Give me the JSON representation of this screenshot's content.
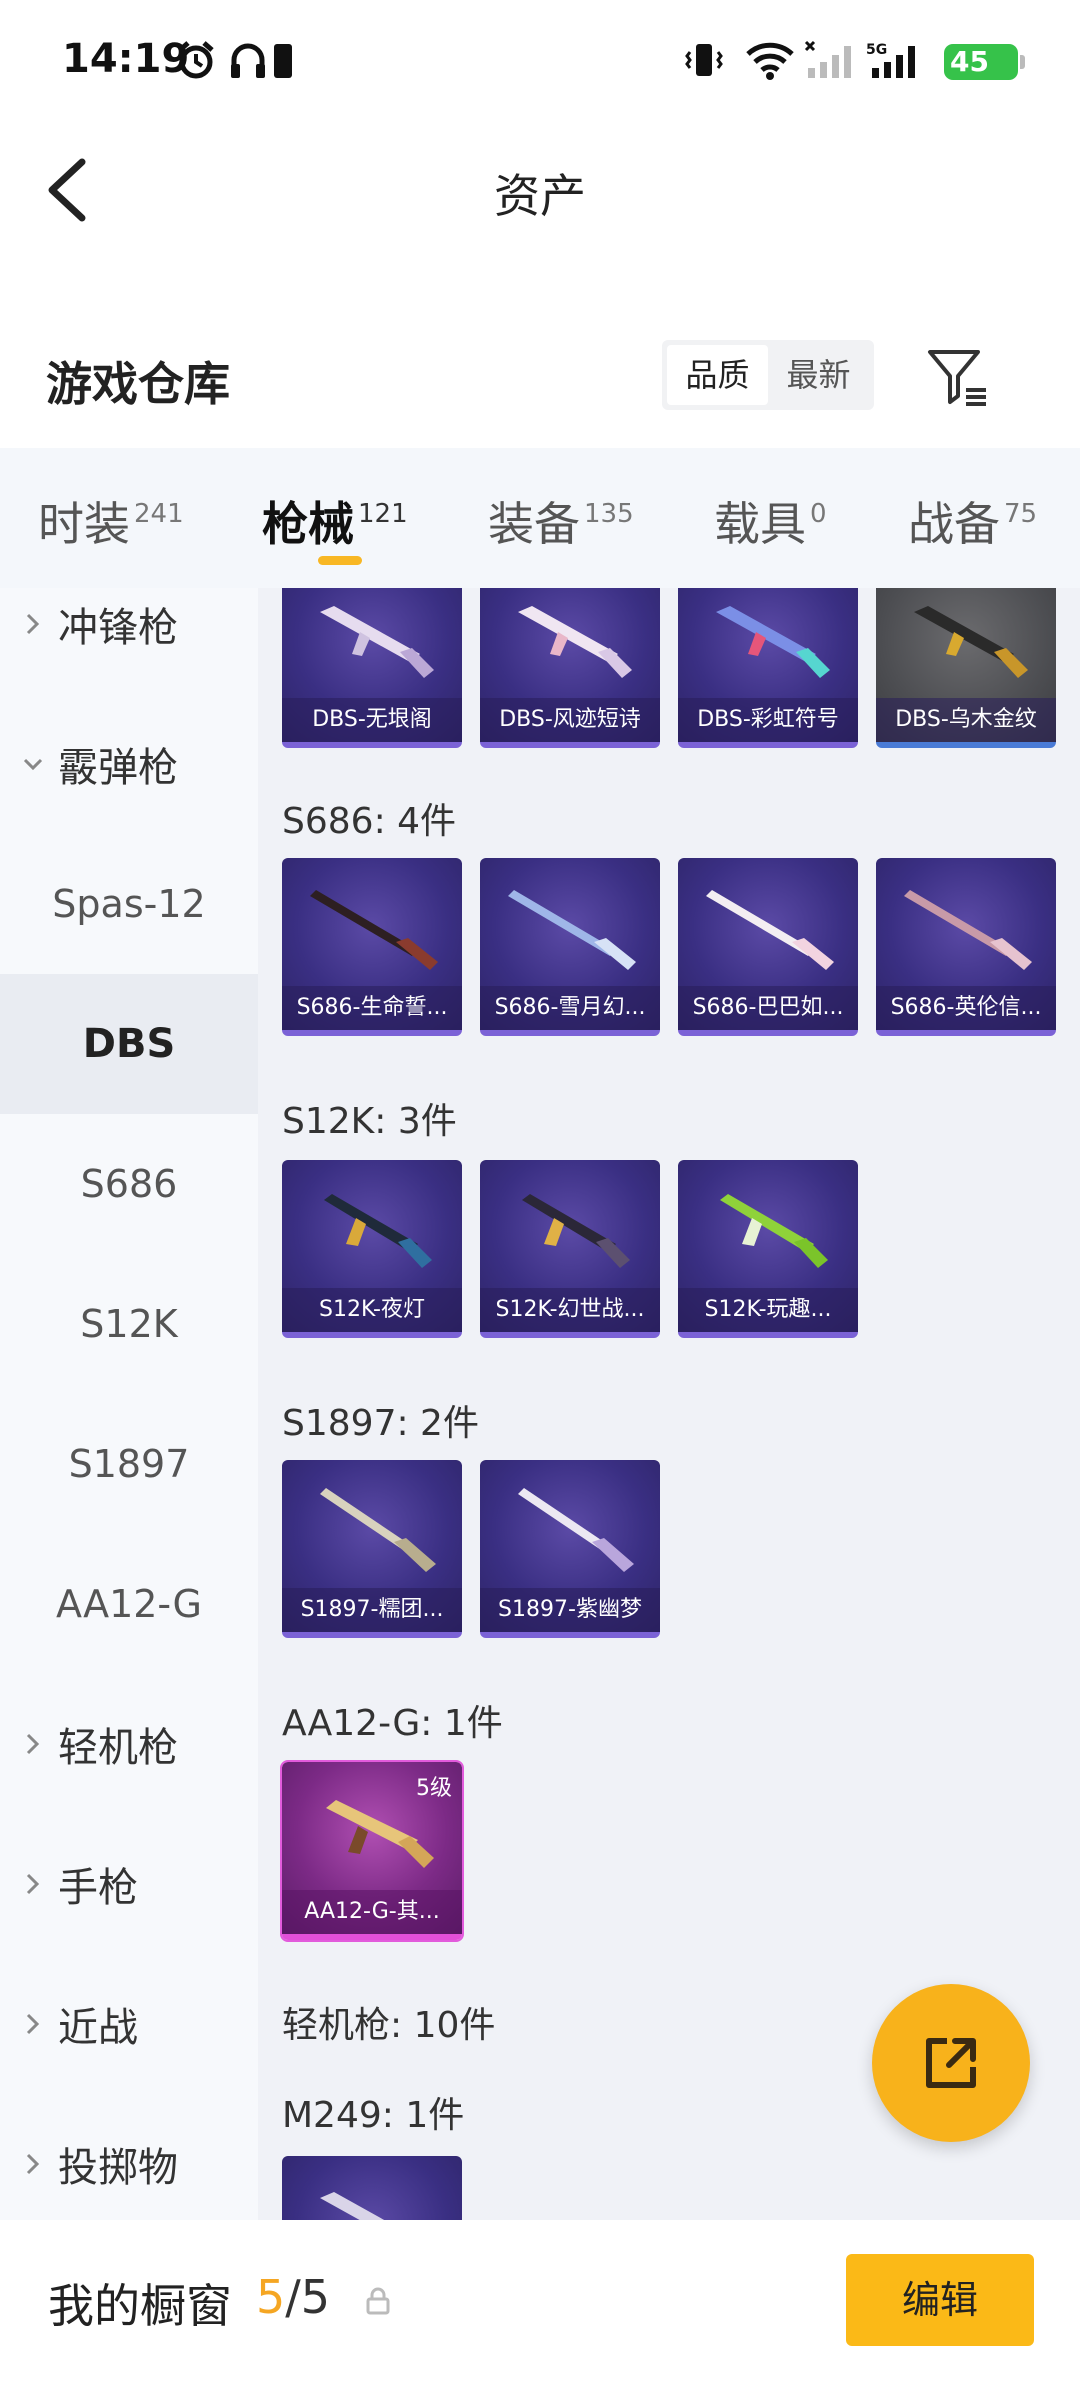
{
  "status_bar": {
    "time": "14:19",
    "battery": "45"
  },
  "header": {
    "title": "资产"
  },
  "warehouse": {
    "title": "游戏仓库",
    "sort_options": [
      "品质",
      "最新"
    ],
    "active_sort": "品质"
  },
  "tabs": [
    {
      "label": "时装",
      "count": "241"
    },
    {
      "label": "枪械",
      "count": "121",
      "active": true
    },
    {
      "label": "装备",
      "count": "135"
    },
    {
      "label": "载具",
      "count": "0"
    },
    {
      "label": "战备",
      "count": "75"
    }
  ],
  "sidebar": {
    "items": [
      {
        "label": "冲锋枪",
        "type": "category",
        "expanded": false
      },
      {
        "label": "霰弹枪",
        "type": "category",
        "expanded": true
      },
      {
        "label": "Spas-12",
        "type": "sub"
      },
      {
        "label": "DBS",
        "type": "sub",
        "selected": true
      },
      {
        "label": "S686",
        "type": "sub"
      },
      {
        "label": "S12K",
        "type": "sub"
      },
      {
        "label": "S1897",
        "type": "sub"
      },
      {
        "label": "AA12-G",
        "type": "sub"
      },
      {
        "label": "轻机枪",
        "type": "category",
        "expanded": false
      },
      {
        "label": "手枪",
        "type": "category",
        "expanded": false
      },
      {
        "label": "近战",
        "type": "category",
        "expanded": false
      },
      {
        "label": "投掷物",
        "type": "category",
        "expanded": false
      }
    ]
  },
  "content": {
    "dbs_items": [
      "DBS-无垠阁",
      "DBS-风迹短诗",
      "DBS-彩虹符号",
      "DBS-乌木金纹"
    ],
    "s686": {
      "label": "S686: 4件",
      "items": [
        "S686-生命誓...",
        "S686-雪月幻...",
        "S686-巴巴如...",
        "S686-英伦信..."
      ]
    },
    "s12k": {
      "label": "S12K: 3件",
      "items": [
        "S12K-夜灯",
        "S12K-幻世战...",
        "S12K-玩趣..."
      ]
    },
    "s1897": {
      "label": "S1897: 2件",
      "items": [
        "S1897-糯团...",
        "S1897-紫幽梦"
      ]
    },
    "aa12g": {
      "label": "AA12-G: 1件",
      "items": [
        "AA12-G-其..."
      ],
      "level": "5级"
    },
    "lmg_label": "轻机枪: 10件",
    "m249_label": "M249: 1件"
  },
  "bottom": {
    "showcase_label": "我的橱窗",
    "showcase_current": "5",
    "showcase_total": "/5",
    "edit_label": "编辑"
  },
  "colors": {
    "accent": "#f8b724",
    "card_purple": "#3a2f83",
    "card_pink": "#7c2a86",
    "battery_green": "#36c24a"
  }
}
